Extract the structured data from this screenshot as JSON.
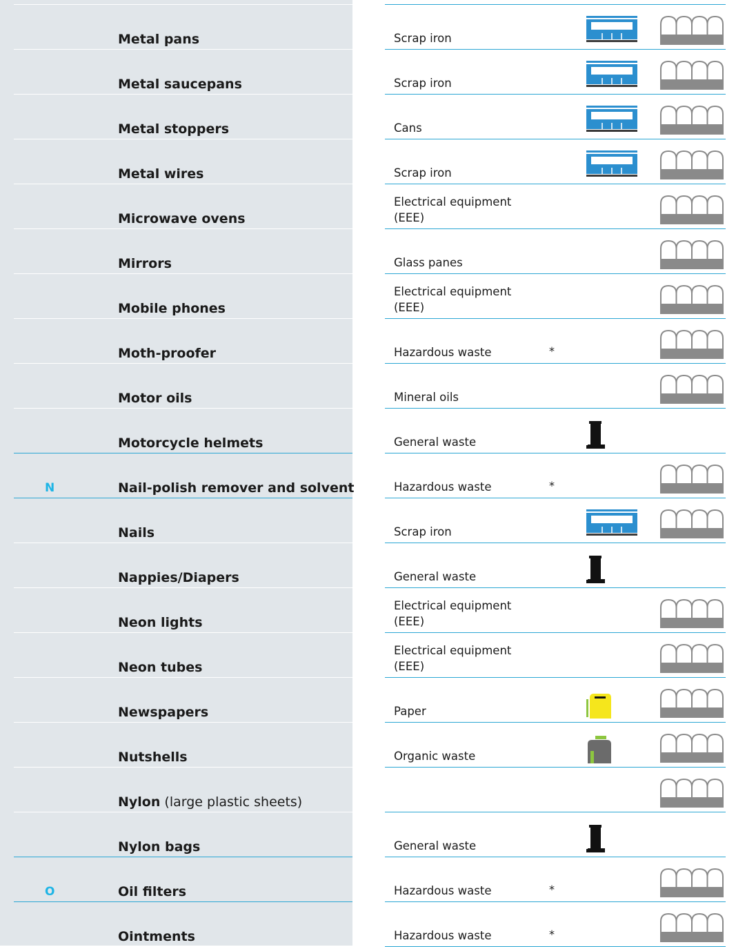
{
  "rows": [
    {
      "letter": "",
      "item": "Metal pans",
      "note": "",
      "category": "Scrap iron",
      "star": "",
      "bin": "scrap-iron-container-icon",
      "center": true
    },
    {
      "letter": "",
      "item": "Metal saucepans",
      "note": "",
      "category": "Scrap iron",
      "star": "",
      "bin": "scrap-iron-container-icon",
      "center": true
    },
    {
      "letter": "",
      "item": "Metal stoppers",
      "note": "",
      "category": "Cans",
      "star": "",
      "bin": "scrap-iron-container-icon",
      "center": true
    },
    {
      "letter": "",
      "item": "Metal wires",
      "note": "",
      "category": "Scrap iron",
      "star": "",
      "bin": "scrap-iron-container-icon",
      "center": true
    },
    {
      "letter": "",
      "item": "Microwave ovens",
      "note": "",
      "category": "Electrical equipment (EEE)",
      "star": "",
      "bin": "",
      "center": true
    },
    {
      "letter": "",
      "item": "Mirrors",
      "note": "",
      "category": "Glass panes",
      "star": "",
      "bin": "",
      "center": true
    },
    {
      "letter": "",
      "item": "Mobile phones",
      "note": "",
      "category": "Electrical equipment (EEE)",
      "star": "",
      "bin": "",
      "center": true
    },
    {
      "letter": "",
      "item": "Moth-proofer",
      "note": "",
      "category": "Hazardous waste",
      "star": "*",
      "bin": "",
      "center": true
    },
    {
      "letter": "",
      "item": "Motor oils",
      "note": "",
      "category": "Mineral oils",
      "star": "",
      "bin": "",
      "center": true
    },
    {
      "letter": "",
      "item": "Motorcycle helmets",
      "note": "",
      "category": "General waste",
      "star": "",
      "bin": "general-waste-bin-icon",
      "center": false
    },
    {
      "letter": "N",
      "item": "Nail-polish remover and solvent",
      "note": "",
      "category": "Hazardous waste",
      "star": "*",
      "bin": "",
      "center": true
    },
    {
      "letter": "",
      "item": "Nails",
      "note": "",
      "category": "Scrap iron",
      "star": "",
      "bin": "scrap-iron-container-icon",
      "center": true
    },
    {
      "letter": "",
      "item": "Nappies/Diapers",
      "note": "",
      "category": "General waste",
      "star": "",
      "bin": "general-waste-bin-icon",
      "center": false
    },
    {
      "letter": "",
      "item": "Neon lights",
      "note": "",
      "category": "Electrical equipment (EEE)",
      "star": "",
      "bin": "",
      "center": true
    },
    {
      "letter": "",
      "item": "Neon tubes",
      "note": "",
      "category": "Electrical equipment (EEE)",
      "star": "",
      "bin": "",
      "center": true
    },
    {
      "letter": "",
      "item": "Newspapers",
      "note": "",
      "category": "Paper",
      "star": "",
      "bin": "paper-bin-icon",
      "center": true
    },
    {
      "letter": "",
      "item": "Nutshells",
      "note": "",
      "category": "Organic waste",
      "star": "",
      "bin": "organic-waste-bin-icon",
      "center": true
    },
    {
      "letter": "",
      "item": "Nylon",
      "note": " (large plastic sheets)",
      "category": "",
      "star": "",
      "bin": "",
      "center": true
    },
    {
      "letter": "",
      "item": "Nylon bags",
      "note": "",
      "category": "General waste",
      "star": "",
      "bin": "general-waste-bin-icon",
      "center": false
    },
    {
      "letter": "O",
      "item": "Oil filters",
      "note": "",
      "category": "Hazardous waste",
      "star": "*",
      "bin": "",
      "center": true
    },
    {
      "letter": "",
      "item": "Ointments",
      "note": "",
      "category": "Hazardous waste",
      "star": "*",
      "bin": "",
      "center": true
    }
  ],
  "colors": {
    "accent": "#2aa6d4",
    "letter": "#1fb5e6",
    "panel": "#e1e6ea",
    "scrap": "#2b8fcf",
    "paper": "#f5e61c",
    "organic": "#6b6b6b",
    "organic_accent": "#8dc63f",
    "center": "#8a8a8a"
  }
}
